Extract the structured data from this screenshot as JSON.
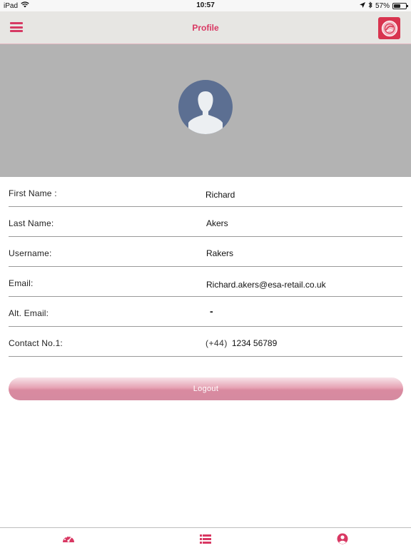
{
  "status_bar": {
    "device": "iPad",
    "time": "10:57",
    "battery": "57%",
    "battery_level": 0.57
  },
  "nav": {
    "title": "Profile",
    "menu_icon": "hamburger-menu-icon",
    "logo_icon": "esa-logo-icon"
  },
  "colors": {
    "accent": "#d93863",
    "header_bg": "#b3b3b3",
    "avatar_bg": "#5c6f92"
  },
  "profile": {
    "fields": [
      {
        "label": "First Name :",
        "value": "Richard"
      },
      {
        "label": "Last Name:",
        "value": "Akers"
      },
      {
        "label": "Username:",
        "value": "Rakers"
      },
      {
        "label": "Email:",
        "value": "Richard.akers@esa-retail.co.uk"
      },
      {
        "label": "Alt. Email:",
        "value": "-"
      },
      {
        "label": "Contact No.1:",
        "country_code": "(+44)",
        "value": "1234 56789"
      }
    ]
  },
  "actions": {
    "logout_label": "Logout"
  },
  "tabs": [
    {
      "icon": "dashboard-gauge-icon"
    },
    {
      "icon": "list-icon"
    },
    {
      "icon": "user-profile-icon"
    }
  ]
}
